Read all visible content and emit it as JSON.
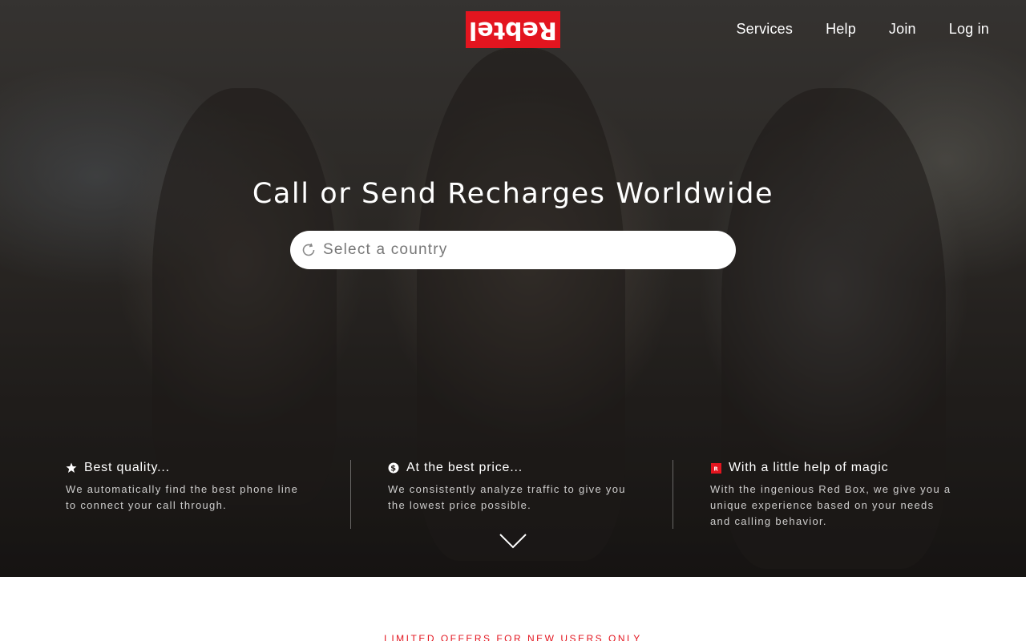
{
  "brand": {
    "name": "Rebtel",
    "color": "#e3151f"
  },
  "nav": {
    "items": [
      {
        "label": "Services"
      },
      {
        "label": "Help"
      },
      {
        "label": "Join"
      },
      {
        "label": "Log in"
      }
    ]
  },
  "hero": {
    "headline": "Call or Send Recharges Worldwide",
    "country_select": {
      "placeholder": "Select a country",
      "icon": "loading-spinner-icon"
    }
  },
  "features": [
    {
      "icon": "star-icon",
      "title": "Best quality...",
      "lines": [
        "We automatically find the best phone line",
        "to connect your call through."
      ]
    },
    {
      "icon": "dollar-icon",
      "title": "At the best price...",
      "lines": [
        "We consistently analyze traffic to give you",
        "the lowest price possible."
      ]
    },
    {
      "icon": "red-box-icon",
      "title": "With a little help of magic",
      "lines": [
        "With the ingenious Red Box, we give you a",
        "unique experience based on your needs",
        "and calling behavior."
      ]
    }
  ],
  "offers_label": "LIMITED OFFERS FOR NEW USERS ONLY"
}
